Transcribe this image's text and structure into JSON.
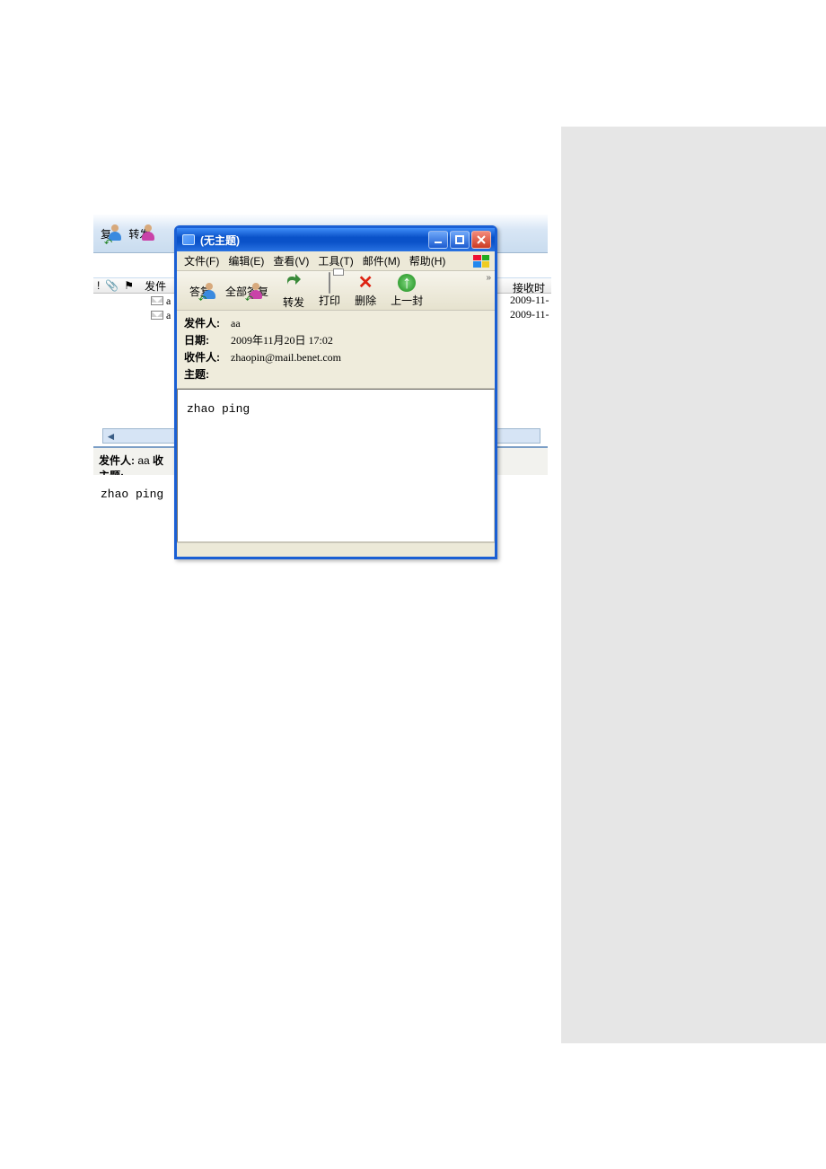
{
  "background": {
    "toolbar": {
      "reply2": "复",
      "forward": "转发"
    },
    "columns": {
      "priority": "!",
      "attach": "⌘",
      "flag": "⚑",
      "from": "发件",
      "received": "接收时"
    },
    "rows": [
      {
        "envelope": true,
        "from": "a",
        "date": "2009-11-"
      },
      {
        "envelope": true,
        "from": "a",
        "date": "2009-11-"
      }
    ],
    "preview": {
      "from_label": "发件人:",
      "from": "aa",
      "to_label": "收",
      "subject_label": "主题:",
      "body": "zhao ping"
    }
  },
  "popup": {
    "title": "(无主题)",
    "menus": [
      {
        "label": "文件",
        "acc": "(F)"
      },
      {
        "label": "编辑",
        "acc": "(E)"
      },
      {
        "label": "查看",
        "acc": "(V)"
      },
      {
        "label": "工具",
        "acc": "(T)"
      },
      {
        "label": "邮件",
        "acc": "(M)"
      },
      {
        "label": "帮助",
        "acc": "(H)"
      }
    ],
    "toolbar": {
      "reply": "答复",
      "reply_all": "全部答复",
      "forward": "转发",
      "print": "打印",
      "delete": "删除",
      "previous": "上一封"
    },
    "header": {
      "from_label": "发件人:",
      "from_value": "aa",
      "date_label": "日期:",
      "date_value": "2009年11月20日 17:02",
      "to_label": "收件人:",
      "to_value": "zhaopin@mail.benet.com",
      "subject_label": "主题:",
      "subject_value": ""
    },
    "body": "zhao ping"
  }
}
